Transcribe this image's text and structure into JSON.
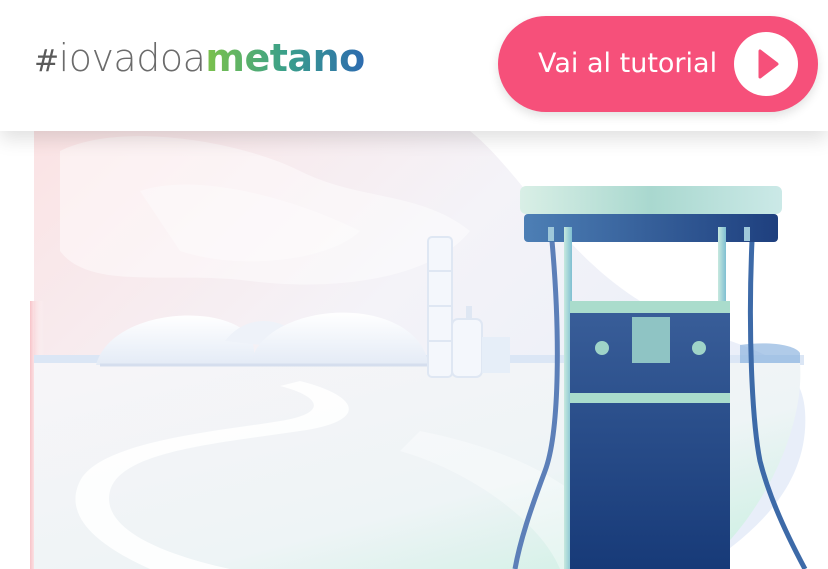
{
  "header": {
    "logo": {
      "hash": "#",
      "light": "iovadoa",
      "bold": "metano"
    },
    "tutorial_button": {
      "label": "Vai al tutorial",
      "icon": "play-icon"
    }
  },
  "hero": {
    "illustration": "fuel-pump-illustration"
  },
  "colors": {
    "accent": "#f6507a",
    "logo_green": "#7cc24a",
    "logo_blue": "#2d6bb0",
    "pump_navy": "#1c3f7d"
  }
}
